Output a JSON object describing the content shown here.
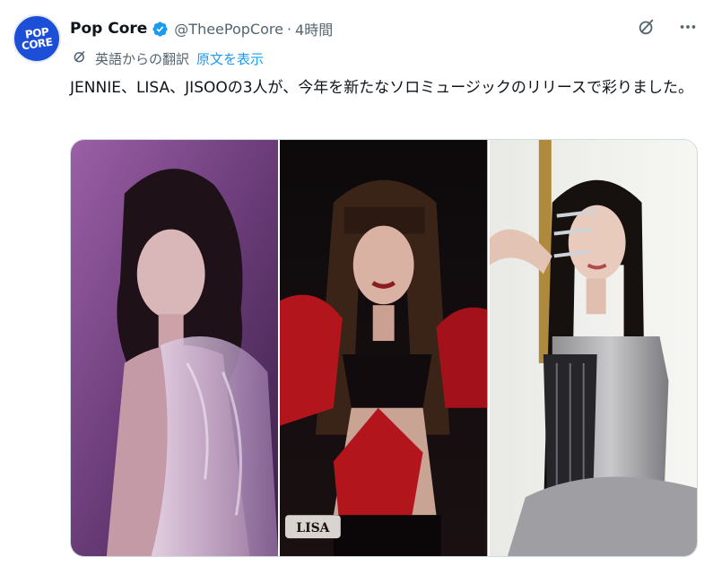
{
  "account": {
    "name": "Pop Core",
    "handle": "@TheePopCore",
    "separator": "·",
    "time": "4時間",
    "avatar_text_line1": "POP",
    "avatar_text_line2": "CORE"
  },
  "translation": {
    "label": "英語からの翻訳",
    "show_original": "原文を表示"
  },
  "tweet": {
    "text": "JENNIE、LISA、JISOOの3人が、今年を新たなソロミュージックのリリースで彩りました。"
  },
  "media": {
    "photos": [
      {
        "label": ""
      },
      {
        "label": "LISA"
      },
      {
        "label": ""
      }
    ]
  },
  "icons": {
    "verified": "verified-badge-icon",
    "translate": "translate-icon",
    "grok": "grok-icon",
    "more": "more-icon"
  },
  "colors": {
    "accent": "#1d9bf0",
    "text": "#0f1419",
    "muted": "#536471",
    "avatar_bg": "#1d4ed8"
  }
}
